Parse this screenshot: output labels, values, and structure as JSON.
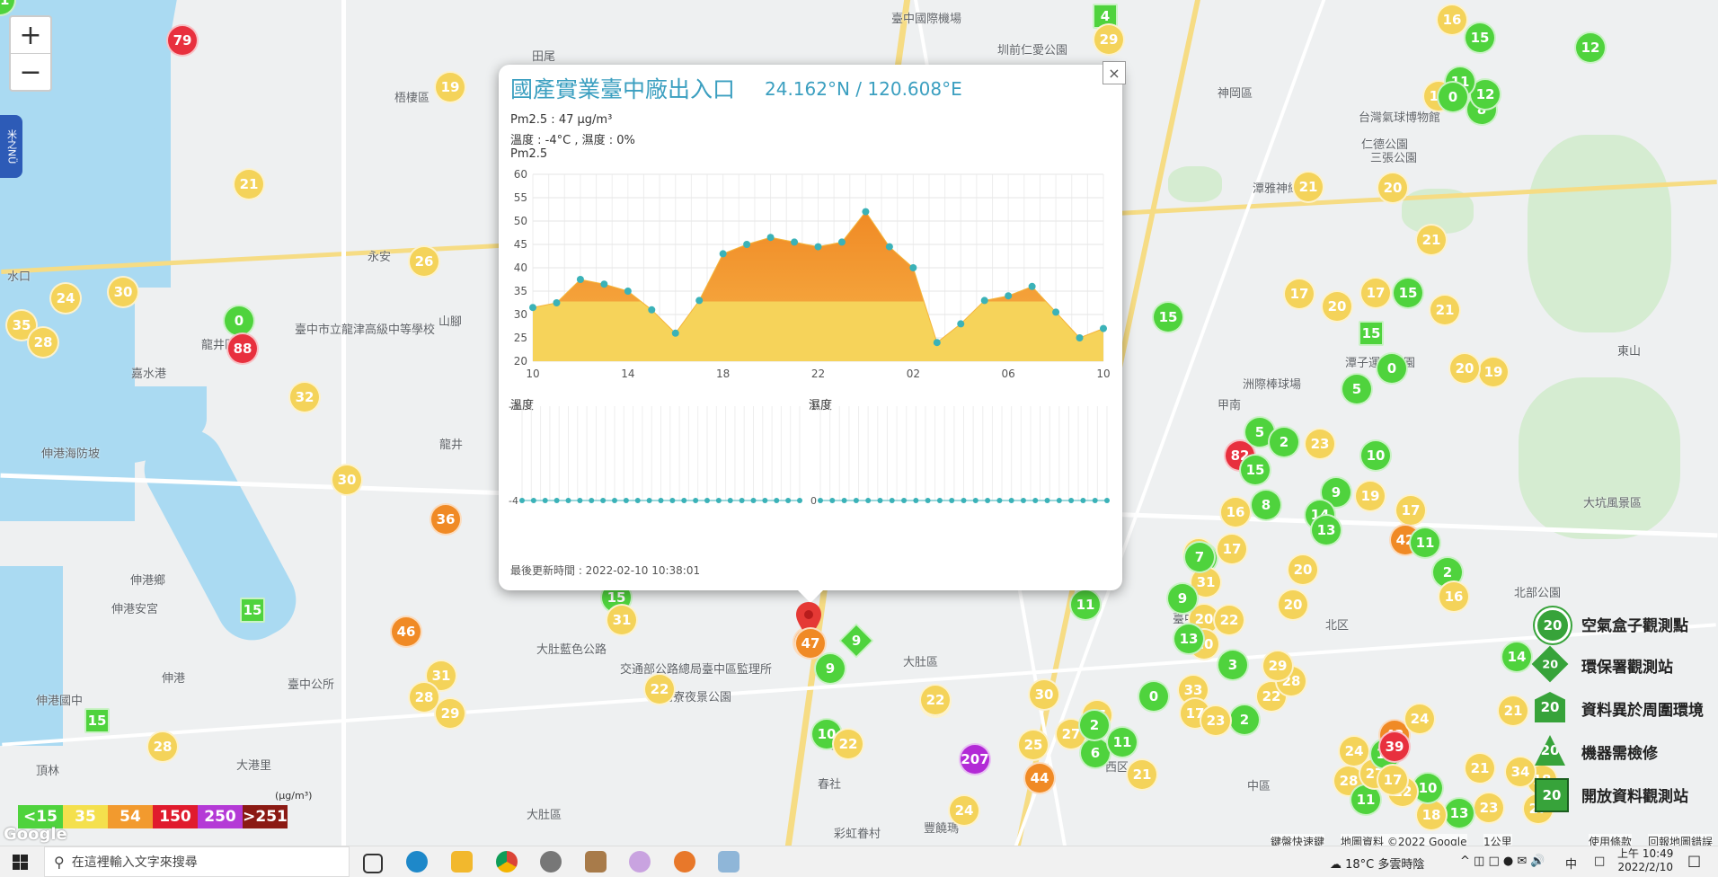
{
  "map": {
    "labels": [
      "臺中國際機場",
      "田尾",
      "圳前仁愛公園",
      "神岡區",
      "梧棲區",
      "台灣氣球博物館",
      "潭雅神綠園道",
      "三張公園",
      "仁德公園",
      "永安",
      "臺中市立龍津高級中等學校",
      "嘉水港",
      "龍井區",
      "山腳",
      "甲南",
      "伸港海防坡",
      "龍井",
      "伸港鄉",
      "伸港安宮",
      "大肚藍色公路",
      "交通部公路總局臺中區監理所",
      "大肚區",
      "望高寮夜景公園",
      "臺中",
      "北区",
      "中區",
      "西区",
      "南屯",
      "春社",
      "彩虹眷村",
      "豐饒瑪",
      "大坑風景區",
      "北部公園",
      "洲際棒球場",
      "潭子運動公園",
      "東山",
      "頂林",
      "大肚區",
      "伸港國中",
      "大港里",
      "臺中公所",
      "水口",
      "伸港"
    ],
    "markers": [
      {
        "v": "79",
        "c": "r"
      },
      {
        "v": "19",
        "c": "y"
      },
      {
        "v": "21",
        "c": "y"
      },
      {
        "v": "24",
        "c": "y"
      },
      {
        "v": "30",
        "c": "y"
      },
      {
        "v": "35",
        "c": "y"
      },
      {
        "v": "28",
        "c": "y"
      },
      {
        "v": "0",
        "c": "g"
      },
      {
        "v": "88",
        "c": "r"
      },
      {
        "v": "26",
        "c": "y"
      },
      {
        "v": "32",
        "c": "y"
      },
      {
        "v": "30",
        "c": "y"
      },
      {
        "v": "36",
        "c": "o"
      },
      {
        "v": "15",
        "c": "g"
      },
      {
        "v": "46",
        "c": "o"
      },
      {
        "v": "31",
        "c": "y"
      },
      {
        "v": "28",
        "c": "y"
      },
      {
        "v": "29",
        "c": "y"
      },
      {
        "v": "15",
        "c": "g"
      },
      {
        "v": "28",
        "c": "y"
      },
      {
        "v": "15",
        "c": "g"
      },
      {
        "v": "31",
        "c": "y"
      },
      {
        "v": "22",
        "c": "y"
      },
      {
        "v": "47",
        "c": "o"
      },
      {
        "v": "9",
        "c": "g"
      },
      {
        "v": "9",
        "c": "g"
      },
      {
        "v": "10",
        "c": "g"
      },
      {
        "v": "22",
        "c": "y"
      },
      {
        "v": "28",
        "c": "y"
      },
      {
        "v": "207",
        "c": "p"
      },
      {
        "v": "44",
        "c": "o"
      },
      {
        "v": "24",
        "c": "y"
      },
      {
        "v": "25",
        "c": "y"
      },
      {
        "v": "22",
        "c": "y"
      },
      {
        "v": "30",
        "c": "y"
      },
      {
        "v": "27",
        "c": "y"
      },
      {
        "v": "25",
        "c": "y"
      },
      {
        "v": "6",
        "c": "g"
      },
      {
        "v": "11",
        "c": "g"
      },
      {
        "v": "21",
        "c": "y"
      },
      {
        "v": "0",
        "c": "g"
      },
      {
        "v": "33",
        "c": "y"
      },
      {
        "v": "17",
        "c": "y"
      },
      {
        "v": "2",
        "c": "g"
      },
      {
        "v": "22",
        "c": "y"
      },
      {
        "v": "28",
        "c": "y"
      },
      {
        "v": "29",
        "c": "y"
      },
      {
        "v": "3",
        "c": "g"
      },
      {
        "v": "23",
        "c": "y"
      },
      {
        "v": "20",
        "c": "y"
      },
      {
        "v": "22",
        "c": "y"
      },
      {
        "v": "16",
        "c": "y"
      },
      {
        "v": "13",
        "c": "g"
      },
      {
        "v": "31",
        "c": "y"
      },
      {
        "v": "20",
        "c": "y"
      },
      {
        "v": "9",
        "c": "g"
      },
      {
        "v": "13",
        "c": "g"
      },
      {
        "v": "11",
        "c": "g"
      },
      {
        "v": "2",
        "c": "g"
      },
      {
        "v": "7",
        "c": "g"
      },
      {
        "v": "17",
        "c": "y"
      },
      {
        "v": "82",
        "c": "r"
      },
      {
        "v": "5",
        "c": "g"
      },
      {
        "v": "2",
        "c": "g"
      },
      {
        "v": "23",
        "c": "y"
      },
      {
        "v": "10",
        "c": "g"
      },
      {
        "v": "15",
        "c": "g"
      },
      {
        "v": "9",
        "c": "g"
      },
      {
        "v": "16",
        "c": "y"
      },
      {
        "v": "8",
        "c": "g"
      },
      {
        "v": "14",
        "c": "g"
      },
      {
        "v": "13",
        "c": "g"
      },
      {
        "v": "20",
        "c": "y"
      },
      {
        "v": "20",
        "c": "y"
      },
      {
        "v": "19",
        "c": "y"
      },
      {
        "v": "21",
        "c": "y"
      },
      {
        "v": "20",
        "c": "y"
      },
      {
        "v": "0",
        "c": "g"
      },
      {
        "v": "5",
        "c": "g"
      },
      {
        "v": "15",
        "c": "g"
      },
      {
        "v": "17",
        "c": "y"
      },
      {
        "v": "20",
        "c": "y"
      },
      {
        "v": "17",
        "c": "y"
      },
      {
        "v": "15",
        "c": "g"
      },
      {
        "v": "19",
        "c": "y"
      },
      {
        "v": "21",
        "c": "y"
      },
      {
        "v": "16",
        "c": "y"
      },
      {
        "v": "15",
        "c": "g"
      },
      {
        "v": "12",
        "c": "g"
      },
      {
        "v": "16",
        "c": "y"
      },
      {
        "v": "8",
        "c": "g"
      },
      {
        "v": "12",
        "c": "g"
      },
      {
        "v": "11",
        "c": "g"
      },
      {
        "v": "0",
        "c": "g"
      },
      {
        "v": "20",
        "c": "y"
      },
      {
        "v": "21",
        "c": "y"
      },
      {
        "v": "15",
        "c": "g"
      },
      {
        "v": "4",
        "c": "g"
      },
      {
        "v": "29",
        "c": "y"
      },
      {
        "v": "17",
        "c": "y"
      },
      {
        "v": "42",
        "c": "o"
      },
      {
        "v": "11",
        "c": "g"
      },
      {
        "v": "2",
        "c": "g"
      },
      {
        "v": "16",
        "c": "y"
      },
      {
        "v": "14",
        "c": "g"
      },
      {
        "v": "21",
        "c": "y"
      },
      {
        "v": "18",
        "c": "y"
      },
      {
        "v": "21",
        "c": "y"
      },
      {
        "v": "34",
        "c": "y"
      },
      {
        "v": "23",
        "c": "y"
      },
      {
        "v": "27",
        "c": "y"
      },
      {
        "v": "13",
        "c": "g"
      },
      {
        "v": "18",
        "c": "y"
      },
      {
        "v": "10",
        "c": "g"
      },
      {
        "v": "22",
        "c": "y"
      },
      {
        "v": "28",
        "c": "y"
      },
      {
        "v": "11",
        "c": "g"
      },
      {
        "v": "24",
        "c": "y"
      },
      {
        "v": "27",
        "c": "y"
      },
      {
        "v": "12",
        "c": "g"
      },
      {
        "v": "43",
        "c": "o"
      },
      {
        "v": "17",
        "c": "y"
      },
      {
        "v": "39",
        "c": "r"
      },
      {
        "v": "24",
        "c": "y"
      },
      {
        "v": "7",
        "c": "y"
      },
      {
        "v": "11",
        "c": "g"
      }
    ]
  },
  "zoom": {
    "in_label": "+",
    "out_label": "−"
  },
  "side_tab": {
    "label": "米之NÜ"
  },
  "popup": {
    "title": "國產實業臺中廠出入口",
    "coords": "24.162°N / 120.608°E",
    "pm_line": "Pm2.5 : 47 μg/m³",
    "weather_line": "溫度 : -4°C , 濕度 : 0%",
    "chart_title": "Pm2.5",
    "temp_title": "溫度",
    "hum_title": "濕度",
    "updated": "最後更新時間 : 2022-02-10 10:38:01",
    "close_label": "×",
    "pin_value": "47"
  },
  "chart_data": [
    {
      "type": "area",
      "title": "Pm2.5",
      "xlabel": "",
      "ylabel": "",
      "ylim": [
        20,
        60
      ],
      "yticks": [
        20,
        25,
        30,
        35,
        40,
        45,
        50,
        55,
        60
      ],
      "xtick_labels": [
        "10",
        "14",
        "18",
        "22",
        "02",
        "06",
        "10"
      ],
      "grid": true,
      "series": [
        {
          "values": [
            31.5,
            32.5,
            37.5,
            36.5,
            35,
            31,
            26,
            33,
            43,
            45,
            46.5,
            45.5,
            44.5,
            45.5,
            52,
            44.5,
            40,
            24,
            28,
            33,
            34,
            36,
            30.5,
            25,
            27
          ]
        }
      ]
    },
    {
      "type": "line",
      "title": "溫度",
      "ylim": [
        -4,
        -3
      ],
      "yticks": [
        -4,
        -3
      ],
      "grid": true,
      "series": [
        {
          "values": [
            -4,
            -4,
            -4,
            -4,
            -4,
            -4,
            -4,
            -4,
            -4,
            -4,
            -4,
            -4,
            -4,
            -4,
            -4,
            -4,
            -4,
            -4,
            -4,
            -4,
            -4,
            -4,
            -4,
            -4,
            -4
          ]
        }
      ]
    },
    {
      "type": "line",
      "title": "濕度",
      "ylim": [
        0,
        1
      ],
      "yticks": [
        0,
        1
      ],
      "grid": true,
      "series": [
        {
          "values": [
            0,
            0,
            0,
            0,
            0,
            0,
            0,
            0,
            0,
            0,
            0,
            0,
            0,
            0,
            0,
            0,
            0,
            0,
            0,
            0,
            0,
            0,
            0,
            0,
            0
          ]
        }
      ]
    }
  ],
  "aqi_legend": {
    "items": [
      {
        "label": "<15",
        "bg": "#4fd33d",
        "fg": "#ffffff"
      },
      {
        "label": "35",
        "bg": "#f4e04d",
        "fg": "#ffffff"
      },
      {
        "label": "54",
        "bg": "#f29a2e",
        "fg": "#ffffff"
      },
      {
        "label": "150",
        "bg": "#e01b2d",
        "fg": "#ffffff"
      },
      {
        "label": "250",
        "bg": "#b43ad6",
        "fg": "#ffffff"
      },
      {
        "label": ">251",
        "bg": "#8b1a14",
        "fg": "#ffffff"
      }
    ],
    "unit": "(μg/m³)"
  },
  "station_legend": [
    {
      "value": "20",
      "label": "空氣盒子觀測點"
    },
    {
      "value": "20",
      "label": "環保署觀測站"
    },
    {
      "value": "20",
      "label": "資料異於周圍環境"
    },
    {
      "value": "20",
      "label": "機器需檢修"
    },
    {
      "value": "20",
      "label": "開放資料觀測站"
    }
  ],
  "google_footer": {
    "shortcuts": "鍵盤快速鍵",
    "copyright": "地圖資料 ©2022 Google",
    "scale": "1公里",
    "terms": "使用條款",
    "report": "回報地圖錯誤",
    "logo": "Google"
  },
  "taskbar": {
    "search_placeholder": "在這裡輸入文字來搜尋",
    "weather": "18°C 多雲時陰",
    "ime": "中",
    "time": "上午 10:49",
    "date": "2022/2/10"
  }
}
